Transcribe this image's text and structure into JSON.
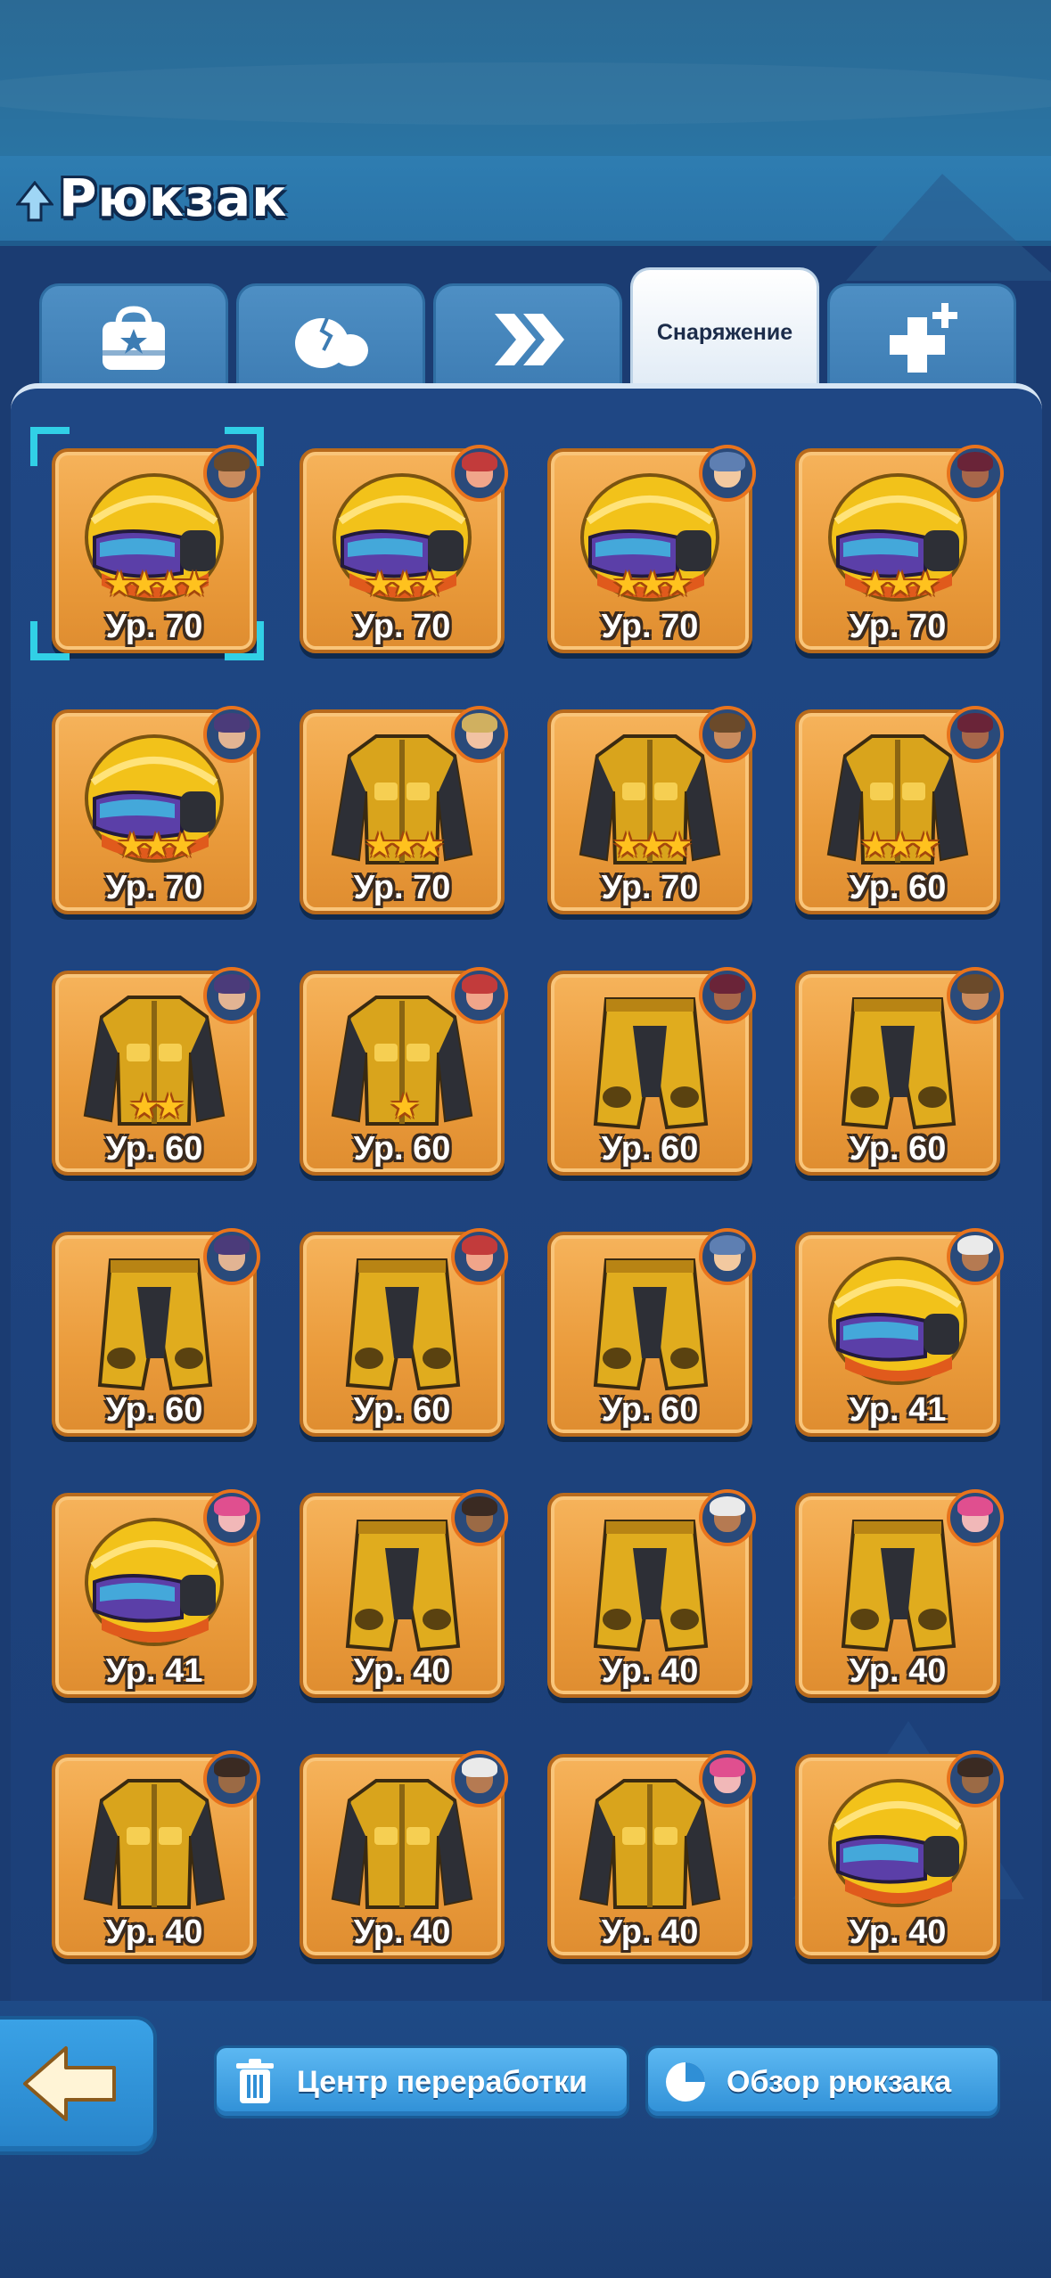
{
  "header": {
    "title": "Рюкзак",
    "title_icon": "tree-icon"
  },
  "tabs": [
    {
      "id": "chest",
      "icon": "bag-star-icon",
      "label": ""
    },
    {
      "id": "fragments",
      "icon": "egg-crack-icon",
      "label": ""
    },
    {
      "id": "boosts",
      "icon": "double-chevron-icon",
      "label": ""
    },
    {
      "id": "gear",
      "icon": "",
      "label": "Снаряжение",
      "active": true
    },
    {
      "id": "medical",
      "icon": "plus-medkit-icon",
      "label": ""
    }
  ],
  "colors": {
    "card_orange": "#ea9b3b",
    "accent_blue": "#2f8fd6",
    "selector": "#31d0e6",
    "star": "#ffc21e"
  },
  "items": [
    {
      "type": "helmet",
      "level": "Ур. 70",
      "stars": 4,
      "avatar": "hero-1",
      "selected": true
    },
    {
      "type": "helmet",
      "level": "Ур. 70",
      "stars": 3,
      "avatar": "hero-2"
    },
    {
      "type": "helmet",
      "level": "Ур. 70",
      "stars": 3,
      "avatar": "hero-3"
    },
    {
      "type": "helmet",
      "level": "Ур. 70",
      "stars": 3,
      "avatar": "hero-4"
    },
    {
      "type": "helmet",
      "level": "Ур. 70",
      "stars": 3,
      "avatar": "hero-5"
    },
    {
      "type": "jacket",
      "level": "Ур. 70",
      "stars": 3,
      "avatar": "hero-6"
    },
    {
      "type": "jacket",
      "level": "Ур. 70",
      "stars": 3,
      "avatar": "hero-1"
    },
    {
      "type": "jacket",
      "level": "Ур. 60",
      "stars": 3,
      "avatar": "hero-4"
    },
    {
      "type": "jacket",
      "level": "Ур. 60",
      "stars": 2,
      "avatar": "hero-5"
    },
    {
      "type": "jacket",
      "level": "Ур. 60",
      "stars": 1,
      "avatar": "hero-2"
    },
    {
      "type": "pants",
      "level": "Ур. 60",
      "stars": 0,
      "avatar": "hero-4"
    },
    {
      "type": "pants",
      "level": "Ур. 60",
      "stars": 0,
      "avatar": "hero-1"
    },
    {
      "type": "pants",
      "level": "Ур. 60",
      "stars": 0,
      "avatar": "hero-5"
    },
    {
      "type": "pants",
      "level": "Ур. 60",
      "stars": 0,
      "avatar": "hero-2"
    },
    {
      "type": "pants",
      "level": "Ур. 60",
      "stars": 0,
      "avatar": "hero-3"
    },
    {
      "type": "helmet",
      "level": "Ур. 41",
      "stars": 0,
      "avatar": "hero-7"
    },
    {
      "type": "helmet",
      "level": "Ур. 41",
      "stars": 0,
      "avatar": "hero-8"
    },
    {
      "type": "pants",
      "level": "Ур. 40",
      "stars": 0,
      "avatar": "hero-9"
    },
    {
      "type": "pants",
      "level": "Ур. 40",
      "stars": 0,
      "avatar": "hero-7"
    },
    {
      "type": "pants",
      "level": "Ур. 40",
      "stars": 0,
      "avatar": "hero-8"
    },
    {
      "type": "jacket",
      "level": "Ур. 40",
      "stars": 0,
      "avatar": "hero-9"
    },
    {
      "type": "jacket",
      "level": "Ур. 40",
      "stars": 0,
      "avatar": "hero-7"
    },
    {
      "type": "jacket",
      "level": "Ур. 40",
      "stars": 0,
      "avatar": "hero-8"
    },
    {
      "type": "helmet",
      "level": "Ур. 40",
      "stars": 0,
      "avatar": "hero-9"
    }
  ],
  "footer": {
    "back_icon": "arrow-left-icon",
    "recycle": {
      "label": "Центр переработки",
      "icon": "trash-icon"
    },
    "overview": {
      "label": "Обзор рюкзака",
      "icon": "pie-chart-icon"
    }
  }
}
